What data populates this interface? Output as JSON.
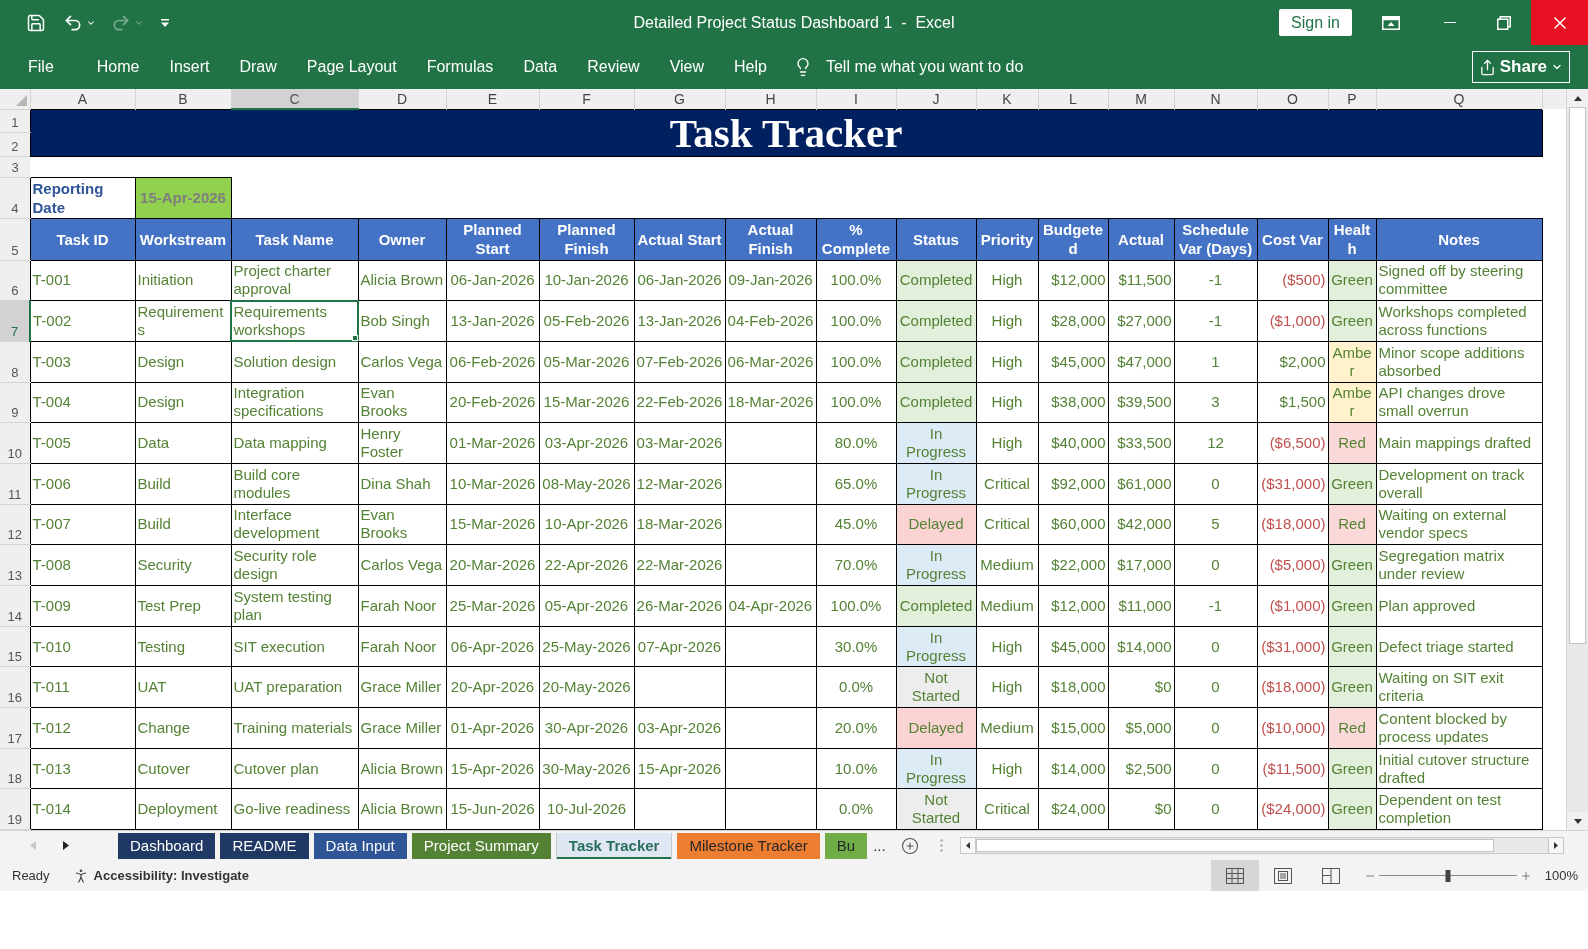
{
  "window": {
    "title": "Detailed Project Status Dashboard 1  -  Excel",
    "sign_in": "Sign in"
  },
  "quick_access": {
    "undo": {
      "disabled": false
    },
    "redo": {
      "disabled": true
    }
  },
  "ribbon": {
    "tabs": [
      "File",
      "Home",
      "Insert",
      "Draw",
      "Page Layout",
      "Formulas",
      "Data",
      "Review",
      "View",
      "Help"
    ],
    "tell_me": {
      "placeholder": "Tell me what you want to do"
    },
    "share": "Share"
  },
  "sheet": {
    "column_headers": [
      {
        "label": "A",
        "selected": false
      },
      {
        "label": "B",
        "selected": false
      },
      {
        "label": "C",
        "selected": true
      },
      {
        "label": "D",
        "selected": false
      },
      {
        "label": "E",
        "selected": false
      },
      {
        "label": "F",
        "selected": false
      },
      {
        "label": "G",
        "selected": false
      },
      {
        "label": "H",
        "selected": false
      },
      {
        "label": "I",
        "selected": false
      },
      {
        "label": "J",
        "selected": false
      },
      {
        "label": "K",
        "selected": false
      },
      {
        "label": "L",
        "selected": false
      },
      {
        "label": "M",
        "selected": false
      },
      {
        "label": "N",
        "selected": false
      },
      {
        "label": "O",
        "selected": false
      },
      {
        "label": "P",
        "selected": false
      },
      {
        "label": "Q",
        "selected": false
      }
    ],
    "row_headers": [
      {
        "label": "1",
        "selected": false
      },
      {
        "label": "2",
        "selected": false
      },
      {
        "label": "3",
        "selected": false
      },
      {
        "label": "4",
        "selected": false
      },
      {
        "label": "5",
        "selected": false
      },
      {
        "label": "6",
        "selected": false
      },
      {
        "label": "7",
        "selected": true
      },
      {
        "label": "8",
        "selected": false
      },
      {
        "label": "9",
        "selected": false
      },
      {
        "label": "10",
        "selected": false
      },
      {
        "label": "11",
        "selected": false
      },
      {
        "label": "12",
        "selected": false
      },
      {
        "label": "13",
        "selected": false
      },
      {
        "label": "14",
        "selected": false
      },
      {
        "label": "15",
        "selected": false
      },
      {
        "label": "16",
        "selected": false
      },
      {
        "label": "17",
        "selected": false
      },
      {
        "label": "18",
        "selected": false
      },
      {
        "label": "19",
        "selected": false
      }
    ],
    "title": "Task Tracker",
    "reporting_date": {
      "label": "Reporting Date",
      "value": "15-Apr-2026"
    },
    "columns": [
      "Task ID",
      "Workstream",
      "Task Name",
      "Owner",
      "Planned Start",
      "Planned Finish",
      "Actual Start",
      "Actual Finish",
      "% Complete",
      "Status",
      "Priority",
      "Budgeted",
      "Actual",
      "Schedule Var (Days)",
      "Cost Var",
      "Health",
      "Notes"
    ],
    "rows": [
      {
        "task_id": "T-001",
        "workstream": "Initiation",
        "task_name": "Project charter approval",
        "owner": "Alicia Brown",
        "planned_start": "06-Jan-2026",
        "planned_finish": "10-Jan-2026",
        "actual_start": "06-Jan-2026",
        "actual_finish": "09-Jan-2026",
        "percent_complete": "100.0%",
        "status": {
          "text": "Completed",
          "kind": "completed"
        },
        "priority": "High",
        "budgeted": "$12,000",
        "actual": "$11,500",
        "schedule_var": "-1",
        "cost_var": {
          "text": "($500)",
          "negative": true
        },
        "health": {
          "text": "Green",
          "kind": "green"
        },
        "notes": "Signed off by steering committee"
      },
      {
        "task_id": "T-002",
        "workstream": "Requirements",
        "task_name": "Requirements workshops",
        "owner": "Bob Singh",
        "planned_start": "13-Jan-2026",
        "planned_finish": "05-Feb-2026",
        "actual_start": "13-Jan-2026",
        "actual_finish": "04-Feb-2026",
        "percent_complete": "100.0%",
        "status": {
          "text": "Completed",
          "kind": "completed"
        },
        "priority": "High",
        "budgeted": "$28,000",
        "actual": "$27,000",
        "schedule_var": "-1",
        "cost_var": {
          "text": "($1,000)",
          "negative": true
        },
        "health": {
          "text": "Green",
          "kind": "green"
        },
        "notes": "Workshops completed across functions"
      },
      {
        "task_id": "T-003",
        "workstream": "Design",
        "task_name": "Solution design",
        "owner": "Carlos Vega",
        "planned_start": "06-Feb-2026",
        "planned_finish": "05-Mar-2026",
        "actual_start": "07-Feb-2026",
        "actual_finish": "06-Mar-2026",
        "percent_complete": "100.0%",
        "status": {
          "text": "Completed",
          "kind": "completed"
        },
        "priority": "High",
        "budgeted": "$45,000",
        "actual": "$47,000",
        "schedule_var": "1",
        "cost_var": {
          "text": "$2,000",
          "negative": false
        },
        "health": {
          "text": "Amber",
          "kind": "amber"
        },
        "notes": "Minor scope additions absorbed"
      },
      {
        "task_id": "T-004",
        "workstream": "Design",
        "task_name": "Integration specifications",
        "owner": "Evan Brooks",
        "planned_start": "20-Feb-2026",
        "planned_finish": "15-Mar-2026",
        "actual_start": "22-Feb-2026",
        "actual_finish": "18-Mar-2026",
        "percent_complete": "100.0%",
        "status": {
          "text": "Completed",
          "kind": "completed"
        },
        "priority": "High",
        "budgeted": "$38,000",
        "actual": "$39,500",
        "schedule_var": "3",
        "cost_var": {
          "text": "$1,500",
          "negative": false
        },
        "health": {
          "text": "Amber",
          "kind": "amber"
        },
        "notes": "API changes drove small overrun"
      },
      {
        "task_id": "T-005",
        "workstream": "Data",
        "task_name": "Data mapping",
        "owner": "Henry Foster",
        "planned_start": "01-Mar-2026",
        "planned_finish": "03-Apr-2026",
        "actual_start": "03-Mar-2026",
        "percent_complete": "80.0%",
        "status": {
          "text": "In Progress",
          "kind": "in_progress"
        },
        "priority": "High",
        "budgeted": "$40,000",
        "actual": "$33,500",
        "schedule_var": "12",
        "cost_var": {
          "text": "($6,500)",
          "negative": true
        },
        "health": {
          "text": "Red",
          "kind": "red"
        },
        "notes": "Main mappings drafted"
      },
      {
        "task_id": "T-006",
        "workstream": "Build",
        "task_name": "Build core modules",
        "owner": "Dina Shah",
        "planned_start": "10-Mar-2026",
        "planned_finish": "08-May-2026",
        "actual_start": "12-Mar-2026",
        "percent_complete": "65.0%",
        "status": {
          "text": "In Progress",
          "kind": "in_progress"
        },
        "priority": "Critical",
        "budgeted": "$92,000",
        "actual": "$61,000",
        "schedule_var": "0",
        "cost_var": {
          "text": "($31,000)",
          "negative": true
        },
        "health": {
          "text": "Green",
          "kind": "green"
        },
        "notes": "Development on track overall"
      },
      {
        "task_id": "T-007",
        "workstream": "Build",
        "task_name": "Interface development",
        "owner": "Evan Brooks",
        "planned_start": "15-Mar-2026",
        "planned_finish": "10-Apr-2026",
        "actual_start": "18-Mar-2026",
        "percent_complete": "45.0%",
        "status": {
          "text": "Delayed",
          "kind": "delayed"
        },
        "priority": "Critical",
        "budgeted": "$60,000",
        "actual": "$42,000",
        "schedule_var": "5",
        "cost_var": {
          "text": "($18,000)",
          "negative": true
        },
        "health": {
          "text": "Red",
          "kind": "red"
        },
        "notes": "Waiting on external vendor specs"
      },
      {
        "task_id": "T-008",
        "workstream": "Security",
        "task_name": "Security role design",
        "owner": "Carlos Vega",
        "planned_start": "20-Mar-2026",
        "planned_finish": "22-Apr-2026",
        "actual_start": "22-Mar-2026",
        "percent_complete": "70.0%",
        "status": {
          "text": "In Progress",
          "kind": "in_progress"
        },
        "priority": "Medium",
        "budgeted": "$22,000",
        "actual": "$17,000",
        "schedule_var": "0",
        "cost_var": {
          "text": "($5,000)",
          "negative": true
        },
        "health": {
          "text": "Green",
          "kind": "green"
        },
        "notes": "Segregation matrix under review"
      },
      {
        "task_id": "T-009",
        "workstream": "Test Prep",
        "task_name": "System testing plan",
        "owner": "Farah Noor",
        "planned_start": "25-Mar-2026",
        "planned_finish": "05-Apr-2026",
        "actual_start": "26-Mar-2026",
        "actual_finish": "04-Apr-2026",
        "percent_complete": "100.0%",
        "status": {
          "text": "Completed",
          "kind": "completed"
        },
        "priority": "Medium",
        "budgeted": "$12,000",
        "actual": "$11,000",
        "schedule_var": "-1",
        "cost_var": {
          "text": "($1,000)",
          "negative": true
        },
        "health": {
          "text": "Green",
          "kind": "green"
        },
        "notes": "Plan approved"
      },
      {
        "task_id": "T-010",
        "workstream": "Testing",
        "task_name": "SIT execution",
        "owner": "Farah Noor",
        "planned_start": "06-Apr-2026",
        "planned_finish": "25-May-2026",
        "actual_start": "07-Apr-2026",
        "percent_complete": "30.0%",
        "status": {
          "text": "In Progress",
          "kind": "in_progress"
        },
        "priority": "High",
        "budgeted": "$45,000",
        "actual": "$14,000",
        "schedule_var": "0",
        "cost_var": {
          "text": "($31,000)",
          "negative": true
        },
        "health": {
          "text": "Green",
          "kind": "green"
        },
        "notes": "Defect triage started"
      },
      {
        "task_id": "T-011",
        "workstream": "UAT",
        "task_name": "UAT preparation",
        "owner": "Grace Miller",
        "planned_start": "20-Apr-2026",
        "planned_finish": "20-May-2026",
        "percent_complete": "0.0%",
        "status": {
          "text": "Not Started",
          "kind": "not_started"
        },
        "priority": "High",
        "budgeted": "$18,000",
        "actual": "$0",
        "schedule_var": "0",
        "cost_var": {
          "text": "($18,000)",
          "negative": true
        },
        "health": {
          "text": "Green",
          "kind": "green"
        },
        "notes": "Waiting on SIT exit criteria"
      },
      {
        "task_id": "T-012",
        "workstream": "Change",
        "task_name": "Training materials",
        "owner": "Grace Miller",
        "planned_start": "01-Apr-2026",
        "planned_finish": "30-Apr-2026",
        "actual_start": "03-Apr-2026",
        "percent_complete": "20.0%",
        "status": {
          "text": "Delayed",
          "kind": "delayed"
        },
        "priority": "Medium",
        "budgeted": "$15,000",
        "actual": "$5,000",
        "schedule_var": "0",
        "cost_var": {
          "text": "($10,000)",
          "negative": true
        },
        "health": {
          "text": "Red",
          "kind": "red"
        },
        "notes": "Content blocked by process updates"
      },
      {
        "task_id": "T-013",
        "workstream": "Cutover",
        "task_name": "Cutover plan",
        "owner": "Alicia Brown",
        "planned_start": "15-Apr-2026",
        "planned_finish": "30-May-2026",
        "actual_start": "15-Apr-2026",
        "percent_complete": "10.0%",
        "status": {
          "text": "In Progress",
          "kind": "in_progress"
        },
        "priority": "High",
        "budgeted": "$14,000",
        "actual": "$2,500",
        "schedule_var": "0",
        "cost_var": {
          "text": "($11,500)",
          "negative": true
        },
        "health": {
          "text": "Green",
          "kind": "green"
        },
        "notes": "Initial cutover structure drafted"
      },
      {
        "task_id": "T-014",
        "workstream": "Deployment",
        "task_name": "Go-live readiness",
        "owner": "Alicia Brown",
        "planned_start": "15-Jun-2026",
        "planned_finish": "10-Jul-2026",
        "percent_complete": "0.0%",
        "status": {
          "text": "Not Started",
          "kind": "not_started"
        },
        "priority": "Critical",
        "budgeted": "$24,000",
        "actual": "$0",
        "schedule_var": "0",
        "cost_var": {
          "text": "($24,000)",
          "negative": true
        },
        "health": {
          "text": "Green",
          "kind": "green"
        },
        "notes": "Dependent on test completion"
      }
    ]
  },
  "sheet_tabs": {
    "nav": {
      "previous": {
        "disabled": true
      },
      "next": {
        "disabled": false
      }
    },
    "tabs": [
      {
        "label": "Dashboard",
        "color": "#203864",
        "selected": false
      },
      {
        "label": "README",
        "color": "#1f3864",
        "selected": false
      },
      {
        "label": "Data Input",
        "color": "#2f5597",
        "selected": false
      },
      {
        "label": "Project Summary",
        "color": "#548235",
        "selected": false
      },
      {
        "label": "Task Tracker",
        "color": "#dfe7f4",
        "selected": true
      },
      {
        "label": "Milestone Tracker",
        "color": "#ed7d31",
        "selected": false
      },
      {
        "label": "Bu",
        "color": "#70ad47",
        "selected": false
      }
    ],
    "overflow": "..."
  },
  "status_bar": {
    "mode": "Ready",
    "accessibility": "Accessibility: Investigate",
    "views": [
      {
        "kind": "normal",
        "selected": true
      },
      {
        "kind": "page_layout",
        "selected": false
      },
      {
        "kind": "page_break",
        "selected": false
      }
    ],
    "zoom": {
      "level": 0.5,
      "reading": "100%"
    }
  }
}
